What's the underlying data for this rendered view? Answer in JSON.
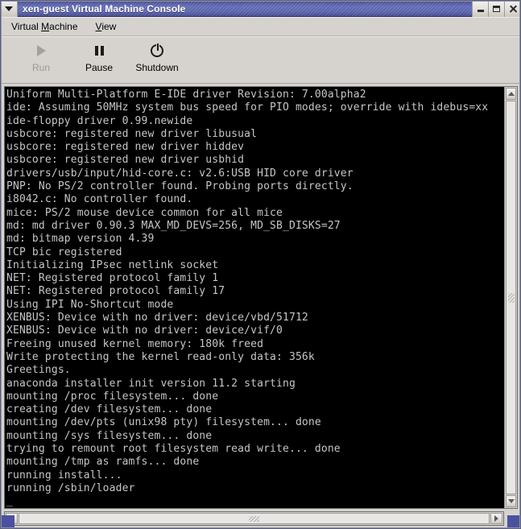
{
  "window": {
    "title": "xen-guest Virtual Machine Console",
    "menu_button_icon": "chevron-down-icon",
    "buttons": {
      "minimize": "minimize-icon",
      "maximize": "maximize-icon",
      "close": "close-icon"
    }
  },
  "menubar": {
    "items": [
      {
        "label": "Virtual Machine",
        "mnemonic": "M",
        "pre": "Virtual ",
        "post": "achine"
      },
      {
        "label": "View",
        "mnemonic": "V",
        "pre": "",
        "post": "iew"
      }
    ]
  },
  "toolbar": {
    "buttons": [
      {
        "label": "Run",
        "icon": "play-icon",
        "enabled": false
      },
      {
        "label": "Pause",
        "icon": "pause-icon",
        "enabled": true
      },
      {
        "label": "Shutdown",
        "icon": "power-icon",
        "enabled": true
      }
    ]
  },
  "console": {
    "background": "#000000",
    "foreground": "#c6c6c6",
    "cursor": "_",
    "lines": [
      "Uniform Multi-Platform E-IDE driver Revision: 7.00alpha2",
      "ide: Assuming 50MHz system bus speed for PIO modes; override with idebus=xx",
      "ide-floppy driver 0.99.newide",
      "usbcore: registered new driver libusual",
      "usbcore: registered new driver hiddev",
      "usbcore: registered new driver usbhid",
      "drivers/usb/input/hid-core.c: v2.6:USB HID core driver",
      "PNP: No PS/2 controller found. Probing ports directly.",
      "i8042.c: No controller found.",
      "mice: PS/2 mouse device common for all mice",
      "md: md driver 0.90.3 MAX_MD_DEVS=256, MD_SB_DISKS=27",
      "md: bitmap version 4.39",
      "TCP bic registered",
      "Initializing IPsec netlink socket",
      "NET: Registered protocol family 1",
      "NET: Registered protocol family 17",
      "Using IPI No-Shortcut mode",
      "XENBUS: Device with no driver: device/vbd/51712",
      "XENBUS: Device with no driver: device/vif/0",
      "Freeing unused kernel memory: 180k freed",
      "Write protecting the kernel read-only data: 356k",
      "Greetings.",
      "anaconda installer init version 11.2 starting",
      "mounting /proc filesystem... done",
      "creating /dev filesystem... done",
      "mounting /dev/pts (unix98 pty) filesystem... done",
      "mounting /sys filesystem... done",
      "trying to remount root filesystem read write... done",
      "mounting /tmp as ramfs... done",
      "running install...",
      "running /sbin/loader"
    ]
  },
  "scrollbars": {
    "vertical": {
      "up_icon": "scroll-up-arrow-icon",
      "down_icon": "scroll-down-arrow-icon",
      "thumb_position": "full"
    },
    "horizontal": {
      "left_icon": "scroll-left-arrow-icon",
      "right_icon": "scroll-right-arrow-icon",
      "thumb_position": "full"
    }
  },
  "colors": {
    "titlebar_blue": "#5a63ad",
    "chrome_grey": "#d6d3ce",
    "accent_blue": "#4a52a0",
    "console_fg": "#c6c6c6"
  }
}
